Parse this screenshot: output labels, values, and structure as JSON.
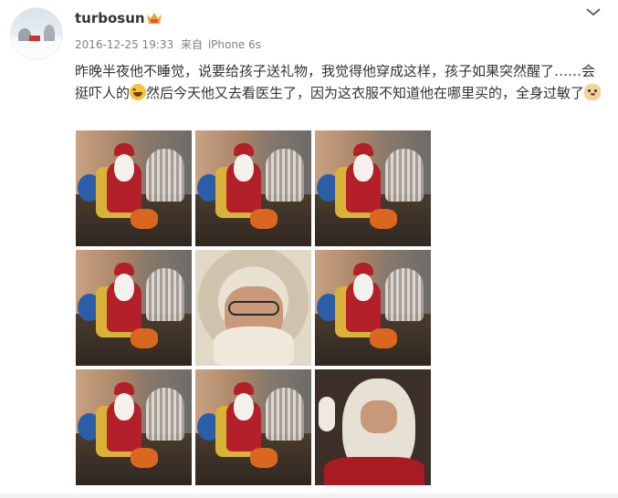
{
  "post": {
    "username": "turbosun",
    "vip_icon": "vip-crown-icon",
    "timestamp": "2016-12-25 19:33",
    "source_prefix": "来自",
    "device": "iPhone 6s",
    "menu_icon": "chevron-down-icon",
    "text_part1": "昨晚半夜他不睡觉，说要给孩子送礼物，我觉得他穿成这样，孩子如果突然醒了……会挺吓人的",
    "emoji1": "laugh-cry-emoji",
    "text_part2": "然后今天他又去看医生了，因为这衣服不知道他在哪里买的，全身过敏了",
    "emoji2": "doge-emoji"
  },
  "photos": [
    {
      "kind": "santa"
    },
    {
      "kind": "santa"
    },
    {
      "kind": "santa"
    },
    {
      "kind": "santa"
    },
    {
      "kind": "closeup"
    },
    {
      "kind": "santa"
    },
    {
      "kind": "santa"
    },
    {
      "kind": "santa"
    },
    {
      "kind": "peace"
    }
  ],
  "colors": {
    "text": "#333333",
    "meta": "#808080",
    "santa_red": "#b3202a"
  }
}
